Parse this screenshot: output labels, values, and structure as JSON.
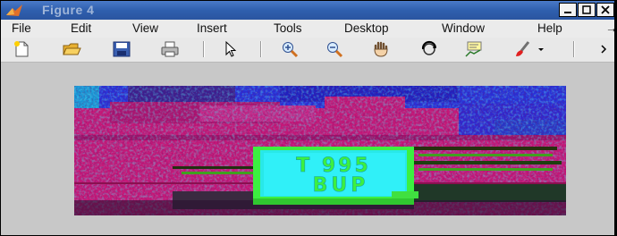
{
  "window": {
    "title": "Figure 4"
  },
  "menu": [
    "File",
    "Edit",
    "View",
    "Insert",
    "Tools",
    "Desktop",
    "Window",
    "Help",
    "→"
  ],
  "toolbar": {
    "buttons": [
      "new-figure",
      "open-file",
      "save-figure",
      "print-figure",
      "select-pointer",
      "zoom-in",
      "zoom-out",
      "pan",
      "rotate-3d",
      "data-cursor",
      "brush",
      "brush-dropdown",
      "more"
    ]
  },
  "plate": {
    "line1": "T 995",
    "line2": "BUP"
  },
  "colors": {
    "plate_green": "#3cf040",
    "plate_cyan": "#2ff0f0",
    "car_magenta": "#c81878",
    "sky_blue": "#2828e6"
  }
}
